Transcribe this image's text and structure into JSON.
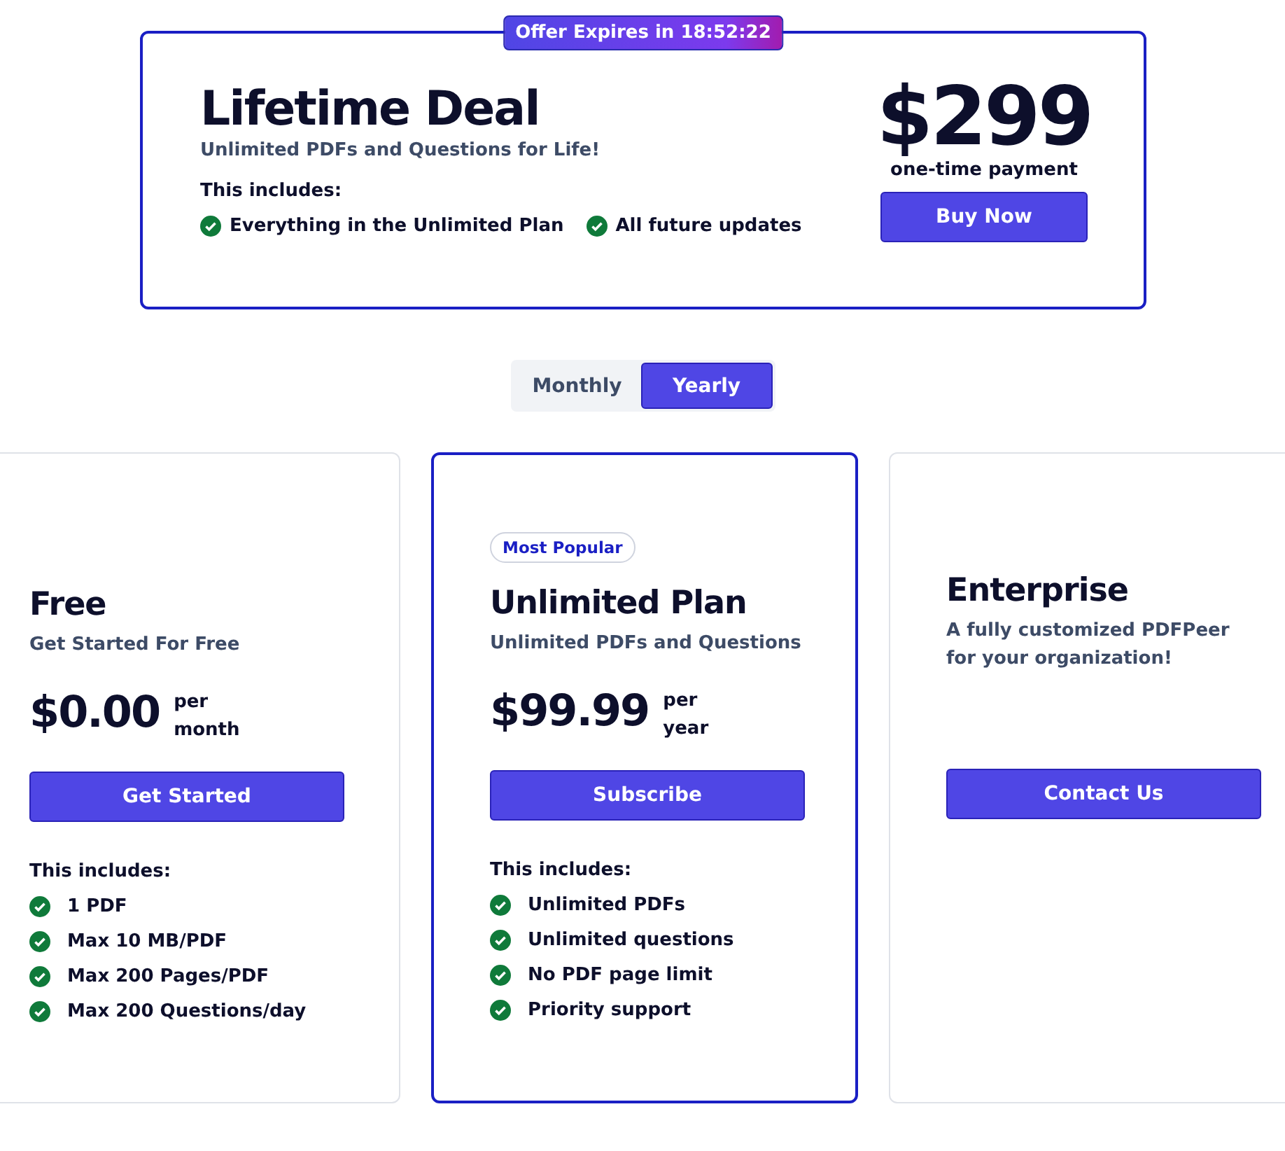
{
  "lifetime": {
    "badge": "Offer Expires in 18:52:22",
    "title": "Lifetime Deal",
    "subtitle": "Unlimited PDFs and Questions for Life!",
    "includes_label": "This includes:",
    "features": [
      "Everything in the Unlimited Plan",
      "All future updates"
    ],
    "price": "$299",
    "price_note": "one-time payment",
    "button": "Buy Now"
  },
  "billing_toggle": [
    {
      "label": "Monthly",
      "selected": false
    },
    {
      "label": "Yearly",
      "selected": true
    }
  ],
  "plans": [
    {
      "name": "Free",
      "subtitle": "Get Started For Free",
      "price": "$0.00",
      "period": [
        "per",
        "month"
      ],
      "button": "Get Started",
      "includes_label": "This includes:",
      "features": [
        "1 PDF",
        "Max 10 MB/PDF",
        "Max 200 Pages/PDF",
        "Max 200 Questions/day"
      ],
      "highlighted": false
    },
    {
      "badge": "Most Popular",
      "name": "Unlimited Plan",
      "subtitle": "Unlimited PDFs and Questions",
      "price": "$99.99",
      "period": [
        "per",
        "year"
      ],
      "button": "Subscribe",
      "includes_label": "This includes:",
      "features": [
        "Unlimited PDFs",
        "Unlimited questions",
        "No PDF page limit",
        "Priority support"
      ],
      "highlighted": true
    },
    {
      "name": "Enterprise",
      "subtitle": "A fully customized PDFPeer for your organization!",
      "button": "Contact Us",
      "highlighted": false
    }
  ]
}
